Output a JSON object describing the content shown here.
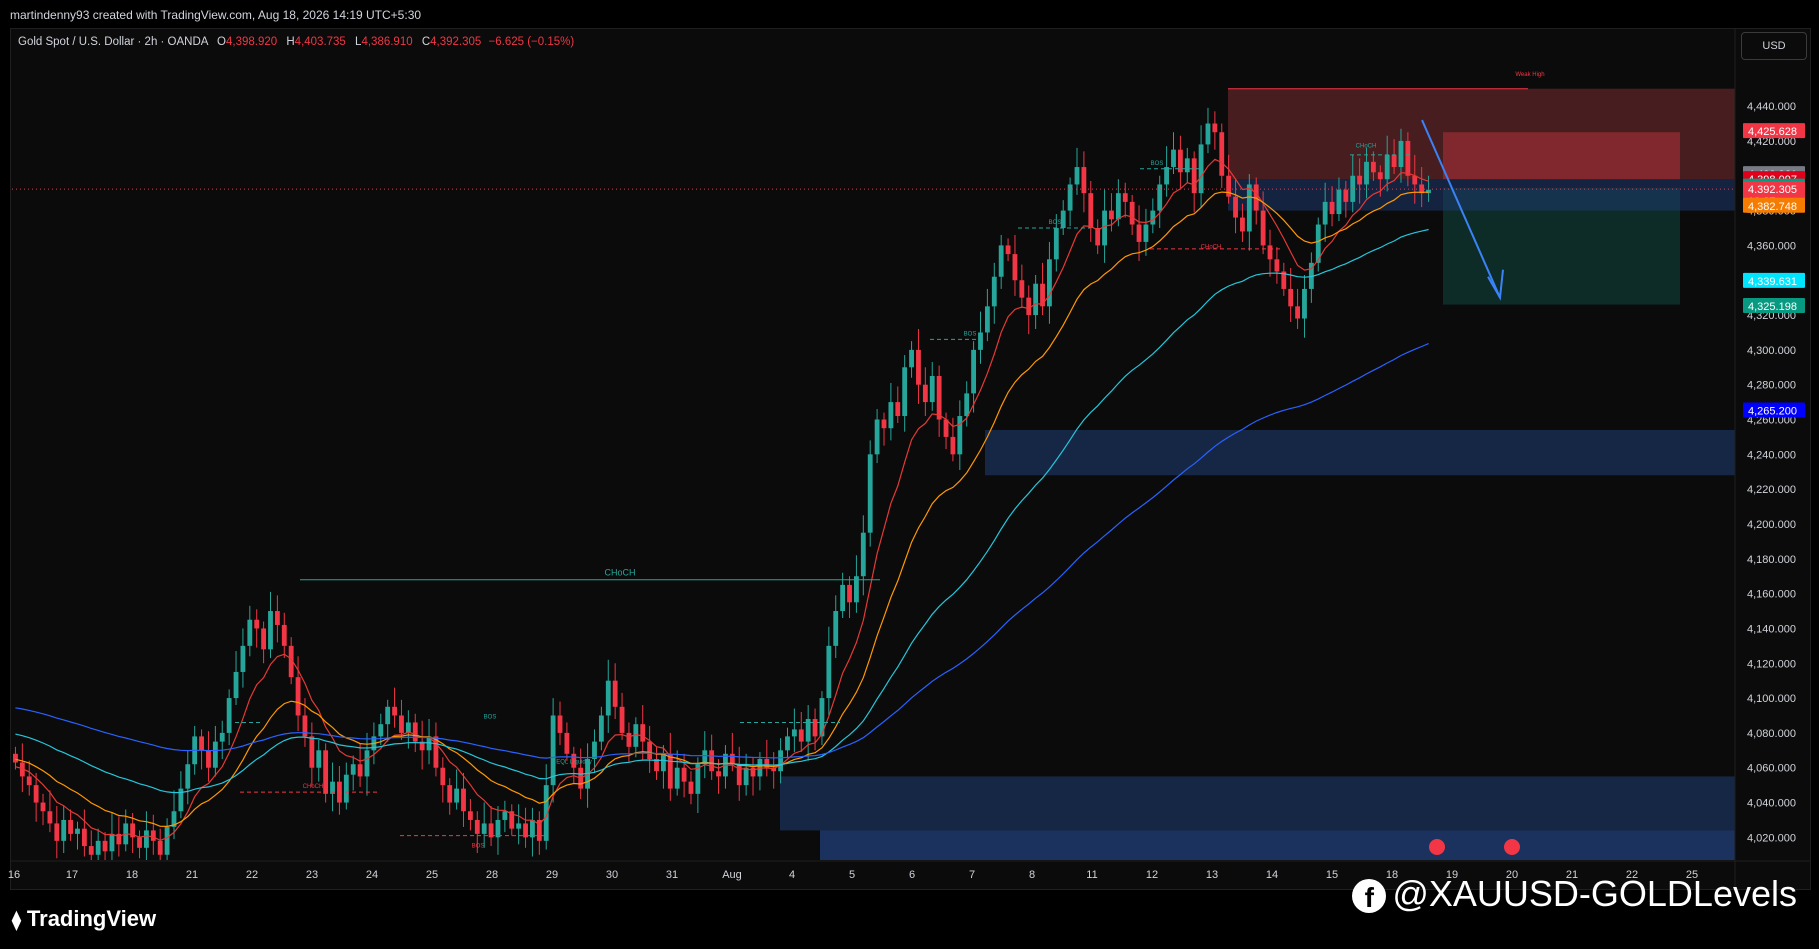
{
  "header": {
    "attribution": "martindenny93 created with TradingView.com, Aug 18, 2026 14:19 UTC+5:30"
  },
  "symbol_bar": {
    "symbol": "Gold Spot / U.S. Dollar · 2h · OANDA",
    "o_label": "O",
    "o_value": "4,398.920",
    "h_label": "H",
    "h_value": "4,403.735",
    "l_label": "L",
    "l_value": "4,386.910",
    "c_label": "C",
    "c_value": "4,392.305",
    "change": "−6.625 (−0.15%)"
  },
  "currency_button": "USD",
  "footer": {
    "brand": "TradingView",
    "brand_icon": "tradingview-logo",
    "watermark": "@XAUUSD-GOLDLevels",
    "watermark_icon": "facebook-icon"
  },
  "colors": {
    "up": "#26a69a",
    "down": "#f23645",
    "ema_fast": "#e53935",
    "ema_mid": "#ff9800",
    "ema_slow": "#26c6da",
    "ema_long": "#2962ff",
    "zone_demand": "#1e3a6e",
    "zone_supply": "#7a2d31"
  },
  "chart_data": {
    "type": "candlestick",
    "timeframe": "2h",
    "x_labels": [
      "16",
      "17",
      "18",
      "21",
      "22",
      "23",
      "24",
      "25",
      "28",
      "29",
      "30",
      "31",
      "Aug",
      "4",
      "5",
      "6",
      "7",
      "8",
      "11",
      "12",
      "13",
      "14",
      "15",
      "18",
      "19",
      "20",
      "21",
      "22",
      "25"
    ],
    "y_ticks": [
      "4,020.000",
      "4,040.000",
      "4,060.000",
      "4,080.000",
      "4,100.000",
      "4,120.000",
      "4,140.000",
      "4,160.000",
      "4,180.000",
      "4,200.000",
      "4,220.000",
      "4,240.000",
      "4,260.000",
      "4,280.000",
      "4,300.000",
      "4,320.000",
      "4,340.000",
      "4,360.000",
      "4,380.000",
      "4,400.000",
      "4,420.000",
      "4,440.000"
    ],
    "ylim": [
      4007,
      4455
    ],
    "closes": [
      4063,
      4055,
      4050,
      4040,
      4035,
      4028,
      4018,
      4030,
      4022,
      4025,
      4015,
      4010,
      4018,
      4012,
      4022,
      4016,
      4028,
      4020,
      4014,
      4024,
      4018,
      4010,
      4026,
      4035,
      4048,
      4062,
      4078,
      4070,
      4060,
      4075,
      4080,
      4100,
      4115,
      4130,
      4145,
      4140,
      4128,
      4150,
      4142,
      4130,
      4112,
      4090,
      4078,
      4060,
      4070,
      4045,
      4052,
      4040,
      4056,
      4062,
      4055,
      4070,
      4078,
      4085,
      4095,
      4090,
      4080,
      4086,
      4075,
      4070,
      4078,
      4060,
      4050,
      4040,
      4048,
      4035,
      4030,
      4022,
      4028,
      4020,
      4030,
      4035,
      4025,
      4028,
      4020,
      4030,
      4018,
      4050,
      4090,
      4080,
      4068,
      4060,
      4048,
      4065,
      4075,
      4090,
      4110,
      4095,
      4080,
      4072,
      4085,
      4075,
      4065,
      4058,
      4068,
      4048,
      4060,
      4052,
      4045,
      4062,
      4070,
      4058,
      4055,
      4068,
      4062,
      4050,
      4060,
      4055,
      4065,
      4060,
      4058,
      4070,
      4078,
      4082,
      4075,
      4088,
      4078,
      4100,
      4130,
      4150,
      4165,
      4155,
      4170,
      4195,
      4240,
      4260,
      4255,
      4270,
      4262,
      4290,
      4300,
      4280,
      4270,
      4285,
      4260,
      4250,
      4240,
      4262,
      4275,
      4300,
      4310,
      4325,
      4342,
      4360,
      4355,
      4340,
      4330,
      4320,
      4338,
      4325,
      4352,
      4370,
      4380,
      4395,
      4405,
      4390,
      4370,
      4360,
      4380,
      4375,
      4390,
      4385,
      4372,
      4362,
      4372,
      4380,
      4395,
      4405,
      4415,
      4402,
      4410,
      4390,
      4418,
      4430,
      4425,
      4400,
      4388,
      4376,
      4368,
      4395,
      4380,
      4360,
      4352,
      4345,
      4335,
      4325,
      4318,
      4335,
      4350,
      4372,
      4385,
      4378,
      4392,
      4385,
      4400,
      4395,
      4408,
      4402,
      4398,
      4412,
      4405,
      4420,
      4400,
      4395,
      4390,
      4392
    ],
    "series": [
      {
        "name": "EMA fast",
        "color": "#e53935"
      },
      {
        "name": "EMA mid",
        "color": "#ff9800"
      },
      {
        "name": "EMA slow",
        "color": "#26c6da"
      },
      {
        "name": "EMA long",
        "color": "#2962ff"
      }
    ],
    "price_labels": [
      {
        "text": "4,425.628",
        "value": 4425.628,
        "color": "#f23645"
      },
      {
        "text": "4,400.961",
        "value": 4400.961,
        "color": "#787b86"
      },
      {
        "text": "4,398.097",
        "value": 4398.097,
        "color": "#e0001b"
      },
      {
        "text": "4,393.760",
        "value": 4393.76,
        "color": "#089981"
      },
      {
        "text": "4,392.305",
        "value": 4392.305,
        "color": "#f23645"
      },
      {
        "text": "10:27",
        "value": 4385.5,
        "color": "#f23645"
      },
      {
        "text": "4,382.748",
        "value": 4382.748,
        "color": "#f57c00"
      },
      {
        "text": "4,339.631",
        "value": 4339.631,
        "color": "#00e5ff"
      },
      {
        "text": "4,325.198",
        "value": 4325.198,
        "color": "#089981"
      },
      {
        "text": "4,265.200",
        "value": 4265.2,
        "color": "#0000ff"
      }
    ],
    "annotations": [
      {
        "text": "CHoCH",
        "price": 4168
      },
      {
        "text": "BOS",
        "price": 4086
      },
      {
        "text": "BOS",
        "price": 4306
      },
      {
        "text": "BOS",
        "price": 4370
      },
      {
        "text": "BOS",
        "price": 4404
      },
      {
        "text": "CHoCH",
        "price": 4356
      },
      {
        "text": "CHoCH",
        "price": 4414
      },
      {
        "text": "CHoCH",
        "price": 4046
      },
      {
        "text": "EQL Liquidity",
        "price": 4060
      },
      {
        "text": "Weak High",
        "price": 4455
      },
      {
        "text": "BOS",
        "price": 4012
      }
    ],
    "current_price": 4392.305
  }
}
